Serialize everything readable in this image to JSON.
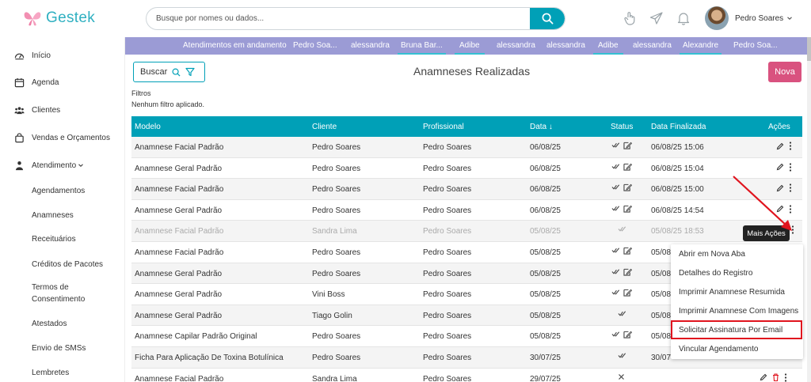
{
  "brand": {
    "name": "Gestek"
  },
  "search": {
    "placeholder": "Busque por nomes ou dados..."
  },
  "user": {
    "name": "Pedro Soares"
  },
  "sidebar": {
    "items": [
      {
        "label": "Início",
        "icon": "dashboard-icon"
      },
      {
        "label": "Agenda",
        "icon": "calendar-icon"
      },
      {
        "label": "Clientes",
        "icon": "users-icon"
      },
      {
        "label": "Vendas e Orçamentos",
        "icon": "shopping-bag-icon"
      },
      {
        "label": "Atendimento",
        "icon": "person-icon"
      }
    ],
    "subitems": [
      "Agendamentos",
      "Anamneses",
      "Receituários",
      "Créditos de Pacotes",
      "Termos de Consentimento",
      "Atestados",
      "Envio de SMSs",
      "Lembretes"
    ]
  },
  "strip": {
    "items": [
      "Atendimentos em andamento",
      "Pedro Soa...",
      "alessandra",
      "Bruna Bar...",
      "Adibe",
      "alessandra",
      "alessandra",
      "Adibe",
      "alessandra",
      "Alexandre",
      "Pedro Soa..."
    ]
  },
  "toolbar": {
    "buscar_label": "Buscar",
    "title": "Anamneses Realizadas",
    "nova_label": "Nova"
  },
  "filters": {
    "label": "Filtros",
    "status": "Nenhum filtro aplicado."
  },
  "table": {
    "headers": [
      "Modelo",
      "Cliente",
      "Profissional",
      "Data",
      "Status",
      "Data Finalizada",
      "Ações"
    ],
    "rows": [
      {
        "modelo": "Anamnese Facial Padrão",
        "cliente": "Pedro Soares",
        "profissional": "Pedro Soares",
        "data": "06/08/25",
        "finalizada": "06/08/25 15:06"
      },
      {
        "modelo": "Anamnese Geral Padrão",
        "cliente": "Pedro Soares",
        "profissional": "Pedro Soares",
        "data": "06/08/25",
        "finalizada": "06/08/25 15:04"
      },
      {
        "modelo": "Anamnese Facial Padrão",
        "cliente": "Pedro Soares",
        "profissional": "Pedro Soares",
        "data": "06/08/25",
        "finalizada": "06/08/25 15:00"
      },
      {
        "modelo": "Anamnese Geral Padrão",
        "cliente": "Pedro Soares",
        "profissional": "Pedro Soares",
        "data": "06/08/25",
        "finalizada": "06/08/25 14:54"
      },
      {
        "modelo": "Anamnese Facial Padrão",
        "cliente": "Sandra Lima",
        "profissional": "Pedro Soares",
        "data": "05/08/25",
        "finalizada": "05/08/25 18:53"
      },
      {
        "modelo": "Anamnese Facial Padrão",
        "cliente": "Pedro Soares",
        "profissional": "Pedro Soares",
        "data": "05/08/25",
        "finalizada": "05/08"
      },
      {
        "modelo": "Anamnese Geral Padrão",
        "cliente": "Pedro Soares",
        "profissional": "Pedro Soares",
        "data": "05/08/25",
        "finalizada": "05/08"
      },
      {
        "modelo": "Anamnese Geral Padrão",
        "cliente": "Vini Boss",
        "profissional": "Pedro Soares",
        "data": "05/08/25",
        "finalizada": "05/08"
      },
      {
        "modelo": "Anamnese Geral Padrão",
        "cliente": "Tiago Golin",
        "profissional": "Pedro Soares",
        "data": "05/08/25",
        "finalizada": "05/08"
      },
      {
        "modelo": "Anamnese Capilar Padrão Original",
        "cliente": "Pedro Soares",
        "profissional": "Pedro Soares",
        "data": "05/08/25",
        "finalizada": "05/08"
      },
      {
        "modelo": "Ficha Para Aplicação De Toxina Botulínica",
        "cliente": "Pedro Soares",
        "profissional": "Pedro Soares",
        "data": "30/07/25",
        "finalizada": "30/07"
      },
      {
        "modelo": "Anamnese Facial Padrão",
        "cliente": "Sandra Lima",
        "profissional": "Pedro Soares",
        "data": "29/07/25",
        "finalizada": ""
      }
    ]
  },
  "tooltip": {
    "label": "Mais Ações"
  },
  "menu": {
    "items": [
      "Abrir em Nova Aba",
      "Detalhes do Registro",
      "Imprimir Anamnese Resumida",
      "Imprimir Anamnese Com Imagens",
      "Solicitar Assinatura Por Email",
      "Vincular Agendamento"
    ]
  },
  "colors": {
    "accent": "#00a0b7",
    "strip": "#9b9bd5",
    "nova": "#d9527f",
    "highlight": "#e0141e"
  }
}
